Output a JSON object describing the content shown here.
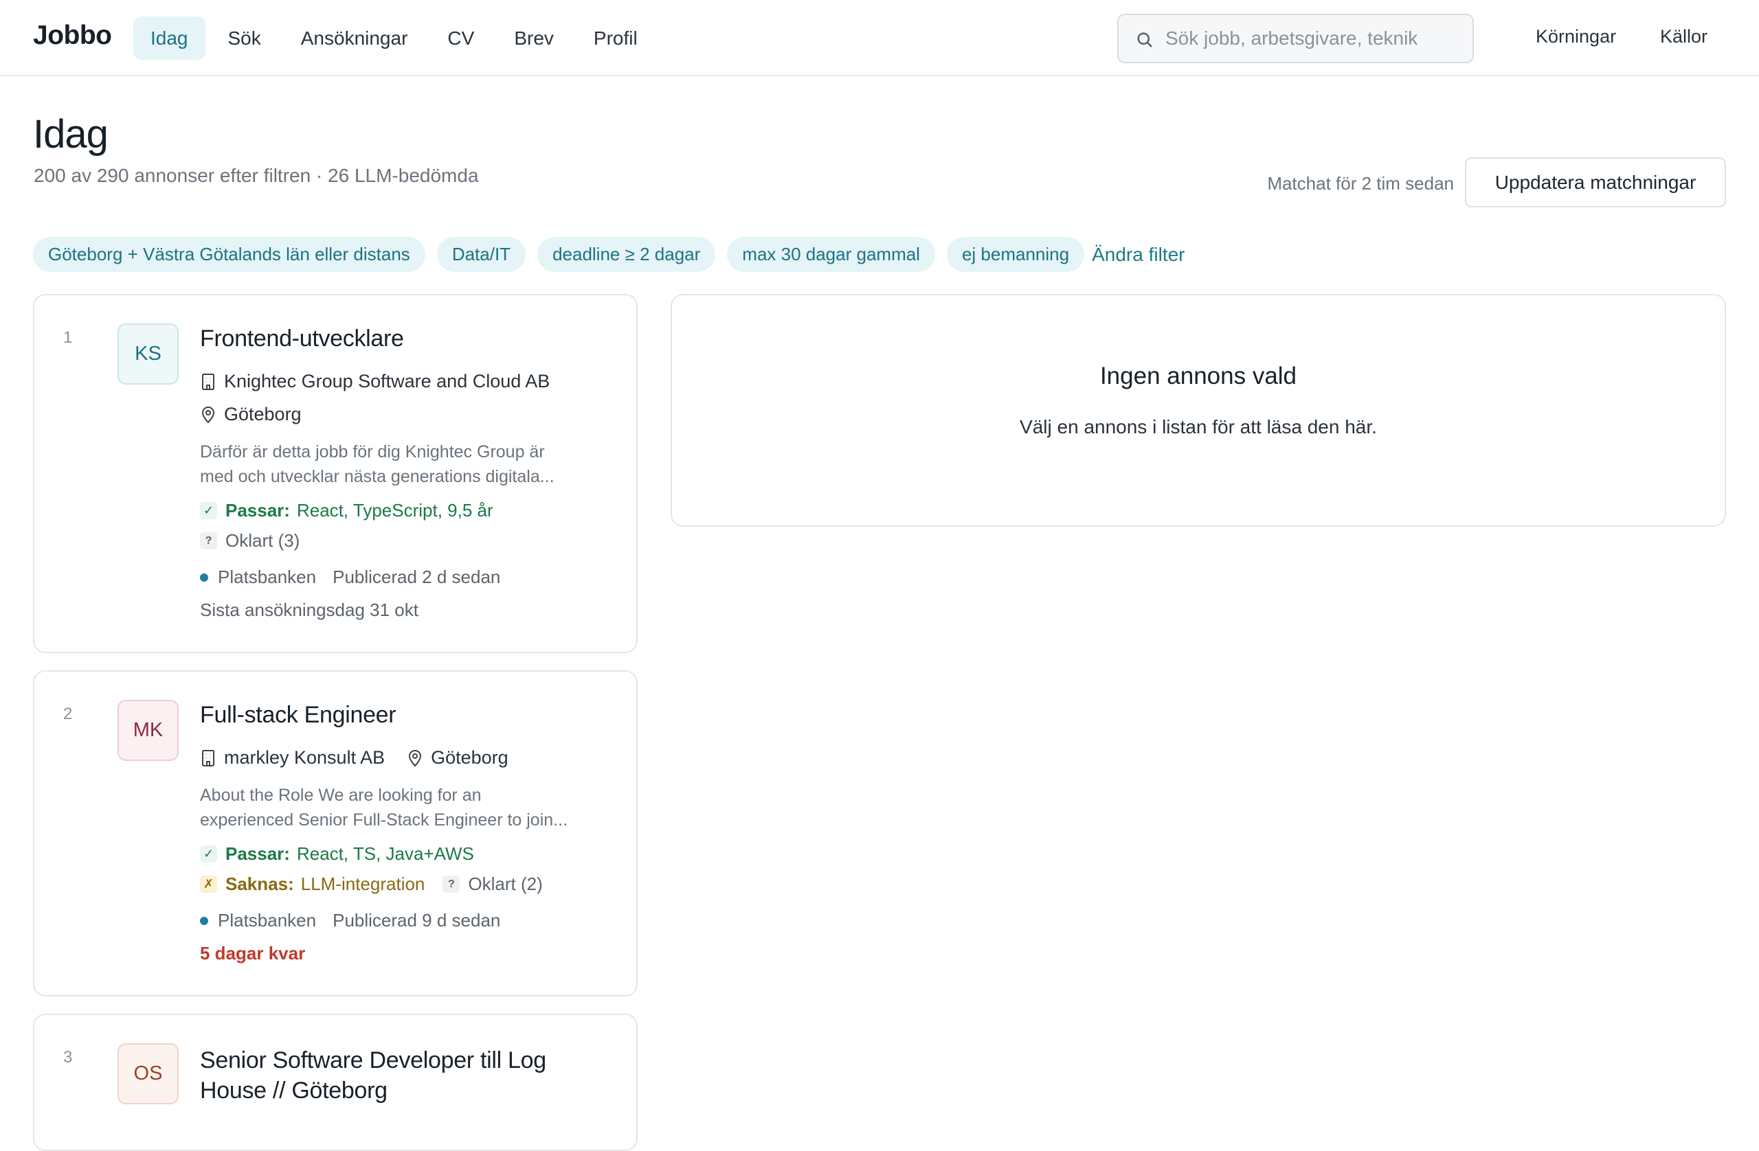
{
  "nav": {
    "brand": "Jobbo",
    "items": [
      {
        "label": "Idag",
        "active": true
      },
      {
        "label": "Sök",
        "active": false
      },
      {
        "label": "Ansökningar",
        "active": false
      },
      {
        "label": "CV",
        "active": false
      },
      {
        "label": "Brev",
        "active": false
      },
      {
        "label": "Profil",
        "active": false
      }
    ],
    "search_placeholder": "Sök jobb, arbetsgivare, teknik",
    "runs_label": "Körningar",
    "sources_label": "Källor"
  },
  "header": {
    "title": "Idag",
    "subtitle": "200 av 290 annonser efter filtren · 26 LLM-bedömda",
    "matched_text": "Matchat för 2 tim sedan",
    "update_button": "Uppdatera matchningar"
  },
  "filters": {
    "chips": [
      "Göteborg + Västra Götalands län eller distans",
      "Data/IT",
      "deadline ≥ 2 dagar",
      "max 30 dagar gammal",
      "ej bemanning"
    ],
    "change_link": "Ändra filter"
  },
  "jobs": [
    {
      "number": "1",
      "initials": "KS",
      "title": "Frontend-utvecklare",
      "company": "Knightec Group Software and Cloud AB",
      "location": "Göteborg",
      "desc_line1": "Därför är detta jobb för dig Knightec Group är",
      "desc_line2": "med och utvecklar nästa generations digitala...",
      "fits_label": "Passar:",
      "fits": "React, TypeScript, 9,5 år",
      "unclear": "Oklart (3)",
      "source": "Platsbanken",
      "published": "Publicerad 2 d sedan",
      "deadline": "Sista ansökningsdag 31 okt"
    },
    {
      "number": "2",
      "initials": "MK",
      "title": "Full-stack Engineer",
      "company": "markley Konsult AB",
      "location": "Göteborg",
      "desc_line1": "About the Role We are looking for an",
      "desc_line2": "experienced Senior Full-Stack Engineer to join...",
      "fits_label": "Passar:",
      "fits": "React, TS, Java+AWS",
      "missing_label": "Saknas:",
      "missing": "LLM-integration",
      "unclear": "Oklart (2)",
      "source": "Platsbanken",
      "published": "Publicerad 9 d sedan",
      "deadline": "5 dagar kvar"
    },
    {
      "number": "3",
      "initials": "OS",
      "title_line1": "Senior Software Developer till Log",
      "title_line2": "House // Göteborg"
    }
  ],
  "detail": {
    "title": "Ingen annons vald",
    "text": "Välj en annons i listan för att läsa den här."
  }
}
